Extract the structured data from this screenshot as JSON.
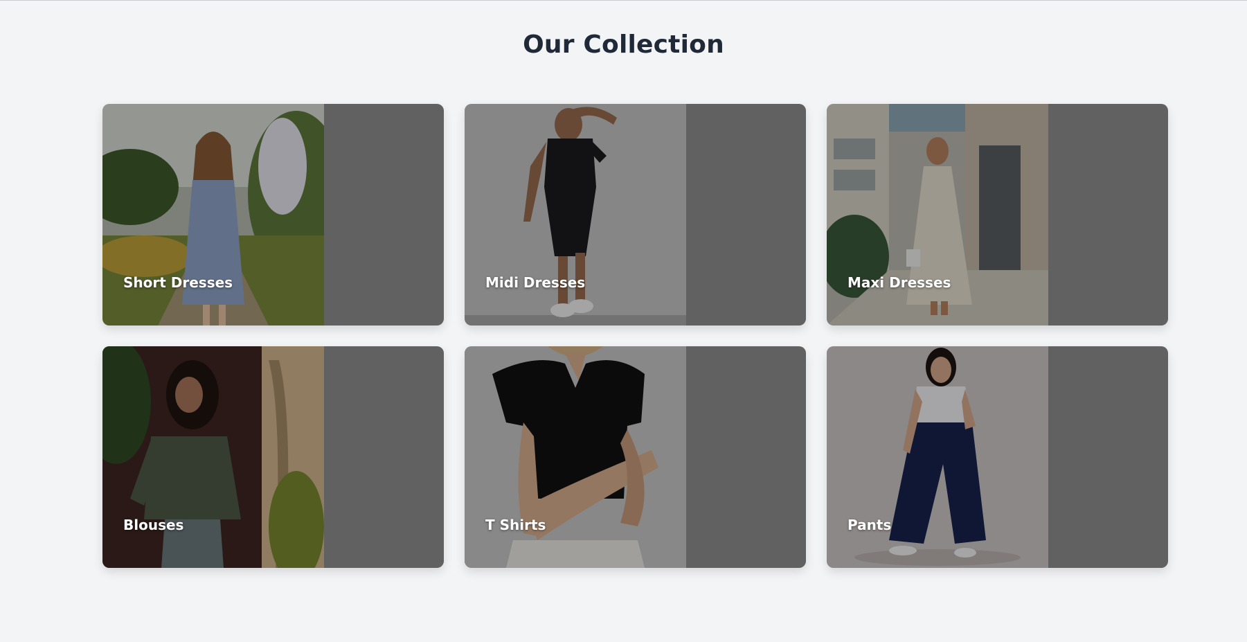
{
  "page": {
    "title": "Our Collection"
  },
  "collections": [
    {
      "label": "Short Dresses",
      "icon": "photo-short-dress",
      "scene": "garden",
      "accent": "#8fa6c9"
    },
    {
      "label": "Midi Dresses",
      "icon": "photo-midi-dress",
      "scene": "wall",
      "accent": "#1b1b1f"
    },
    {
      "label": "Maxi Dresses",
      "icon": "photo-maxi-dress",
      "scene": "street",
      "accent": "#e7e0d2"
    },
    {
      "label": "Blouses",
      "icon": "photo-blouse",
      "scene": "plants",
      "accent": "#4f5b48"
    },
    {
      "label": "T Shirts",
      "icon": "photo-t-shirt",
      "scene": "studio",
      "accent": "#111111"
    },
    {
      "label": "Pants",
      "icon": "photo-pants",
      "scene": "studio-light",
      "accent": "#17224f"
    }
  ],
  "colors": {
    "background": "#f3f4f6",
    "title": "#1f2937",
    "card_fill": "#8f8f90",
    "label": "#ffffff"
  }
}
